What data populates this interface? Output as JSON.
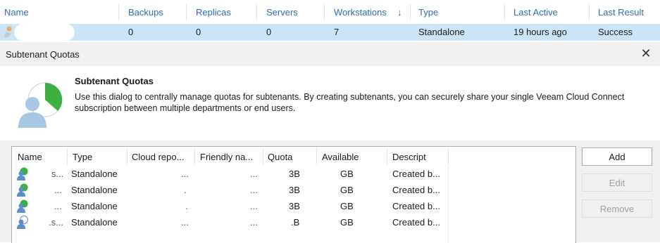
{
  "background_grid": {
    "columns": [
      "Name",
      "Backups",
      "Replicas",
      "Servers",
      "Workstations",
      "Type",
      "Last Active",
      "Last Result"
    ],
    "sort_arrow": "↓",
    "row": {
      "backups": "0",
      "replicas": "0",
      "servers": "0",
      "workstations": "7",
      "type": "Standalone",
      "last_active": "19 hours  ago",
      "last_result": "Success"
    }
  },
  "dialog": {
    "window_title": "Subtenant Quotas",
    "close_glyph": "✕",
    "banner_title": "Subtenant Quotas",
    "banner_description": "Use this dialog to centrally manage quotas for subtenants. By creating subtenants, you can securely share your single Veeam Cloud Connect subscription between multiple departments or end users.",
    "list": {
      "headers": [
        "Name",
        "Type",
        "Cloud repo...",
        "Friendly na...",
        "Quota",
        "Available",
        "Descript"
      ],
      "rows": [
        {
          "name": "s...",
          "type": "Standalone",
          "cloud": "...",
          "friendly": "...",
          "quota": "3B",
          "available": "GB",
          "description": "Created b..."
        },
        {
          "name": "...",
          "type": "Standalone",
          "cloud": ".",
          "friendly": "...",
          "quota": "3B",
          "available": "GB",
          "description": "Created b..."
        },
        {
          "name": "...",
          "type": "Standalone",
          "cloud": ".",
          "friendly": "...",
          "quota": "3B",
          "available": "GB",
          "description": "Created b..."
        },
        {
          "name": ".s...",
          "type": "Standalone",
          "cloud": "...",
          "friendly": "...",
          "quota": ".B",
          "available": "GB",
          "description": "Created b..."
        }
      ]
    },
    "buttons": {
      "add": "Add",
      "edit": "Edit",
      "remove": "Remove"
    }
  },
  "colors": {
    "header_link": "#2a6fb8",
    "selected_row": "#cce4f7",
    "dialog_bg": "#f0f0f0",
    "pie_green": "#3cb043",
    "avatar_blue": "#a9c7e3"
  }
}
